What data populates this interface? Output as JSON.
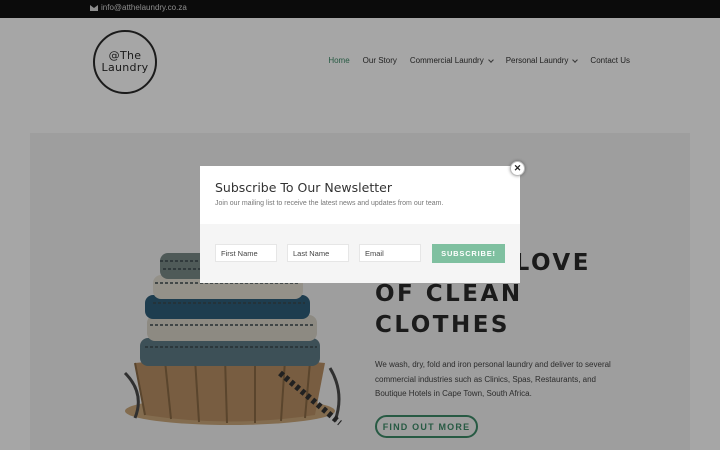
{
  "topbar": {
    "email": "info@atthelaundry.co.za",
    "email_icon": "mail-icon"
  },
  "logo": {
    "line1": "@The",
    "line2": "Laundry"
  },
  "nav": {
    "home": "Home",
    "our_story": "Our Story",
    "commercial": "Commercial Laundry",
    "personal": "Personal Laundry",
    "contact": "Contact Us"
  },
  "hero": {
    "heading_line1": "FOR THE LOVE",
    "heading_line2": "OF CLEAN",
    "heading_line3": "CLOTHES",
    "description": "We wash, dry, fold and iron personal laundry and deliver to several commercial industries such as Clinics, Spas, Restaurants, and Boutique Hotels in Cape Town, South Africa.",
    "cta": "FIND OUT MORE"
  },
  "modal": {
    "title": "Subscribe To Our Newsletter",
    "subtitle": "Join our mailing list to receive the latest news and updates from our team.",
    "first_name_placeholder": "First Name",
    "last_name_placeholder": "Last Name",
    "email_placeholder": "Email",
    "subscribe_label": "SUBSCRIBE!",
    "close_symbol": "✕"
  },
  "colors": {
    "accent": "#3d8a68",
    "button": "#7fc0a0",
    "topbar": "#111111"
  }
}
